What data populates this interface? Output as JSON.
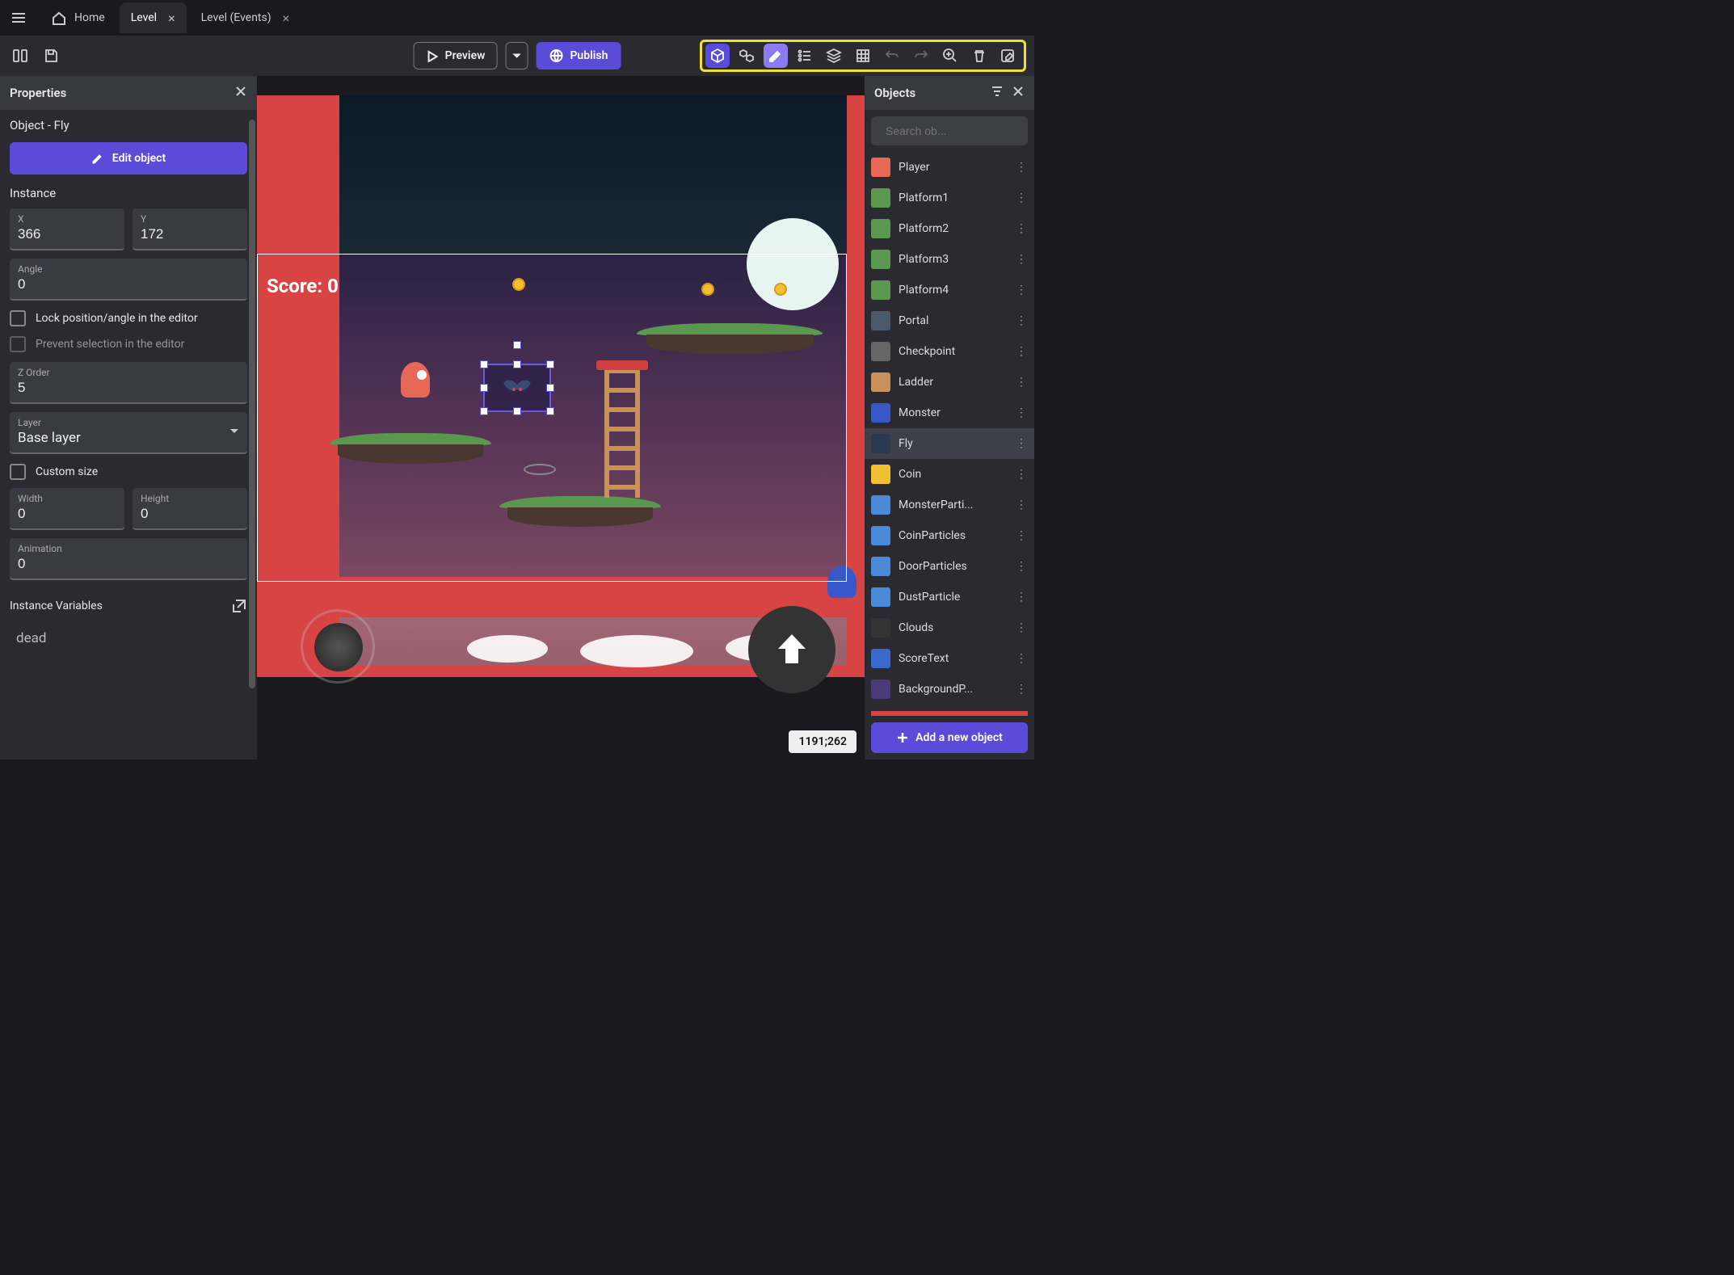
{
  "tabs": {
    "home": "Home",
    "level": "Level",
    "events": "Level (Events)"
  },
  "toolbar": {
    "preview": "Preview",
    "publish": "Publish"
  },
  "properties": {
    "panel_title": "Properties",
    "object_label": "Object  - Fly",
    "edit_object": "Edit object",
    "instance_label": "Instance",
    "x": {
      "label": "X",
      "value": "366"
    },
    "y": {
      "label": "Y",
      "value": "172"
    },
    "angle": {
      "label": "Angle",
      "value": "0"
    },
    "lock_pos": "Lock position/angle in the editor",
    "prevent_sel": "Prevent selection in the editor",
    "zorder": {
      "label": "Z Order",
      "value": "5"
    },
    "layer": {
      "label": "Layer",
      "value": "Base layer"
    },
    "custom_size": "Custom size",
    "width": {
      "label": "Width",
      "value": "0"
    },
    "height": {
      "label": "Height",
      "value": "0"
    },
    "animation": {
      "label": "Animation",
      "value": "0"
    },
    "instance_vars": "Instance Variables",
    "dead": "dead"
  },
  "objects_panel": {
    "title": "Objects",
    "search_placeholder": "Search ob...",
    "add_button": "Add a new object",
    "items": [
      {
        "name": "Player",
        "thumb_bg": "#e86858"
      },
      {
        "name": "Platform1",
        "thumb_bg": "#5a9850"
      },
      {
        "name": "Platform2",
        "thumb_bg": "#5a9850"
      },
      {
        "name": "Platform3",
        "thumb_bg": "#5a9850"
      },
      {
        "name": "Platform4",
        "thumb_bg": "#5a9850"
      },
      {
        "name": "Portal",
        "thumb_bg": "#4a5a6a"
      },
      {
        "name": "Checkpoint",
        "thumb_bg": "#666"
      },
      {
        "name": "Ladder",
        "thumb_bg": "#c8905a"
      },
      {
        "name": "Monster",
        "thumb_bg": "#3858c8"
      },
      {
        "name": "Fly",
        "thumb_bg": "#2a3850",
        "selected": true
      },
      {
        "name": "Coin",
        "thumb_bg": "#f0c030"
      },
      {
        "name": "MonsterParti...",
        "thumb_bg": "#4a8ad8"
      },
      {
        "name": "CoinParticles",
        "thumb_bg": "#4a8ad8"
      },
      {
        "name": "DoorParticles",
        "thumb_bg": "#4a8ad8"
      },
      {
        "name": "DustParticle",
        "thumb_bg": "#4a8ad8"
      },
      {
        "name": "Clouds",
        "thumb_bg": "#333"
      },
      {
        "name": "ScoreText",
        "thumb_bg": "#3a6ad0"
      },
      {
        "name": "BackgroundP...",
        "thumb_bg": "#4a3a7a"
      }
    ]
  },
  "canvas": {
    "score_label": "Score: 0",
    "coords": "1191;262"
  }
}
